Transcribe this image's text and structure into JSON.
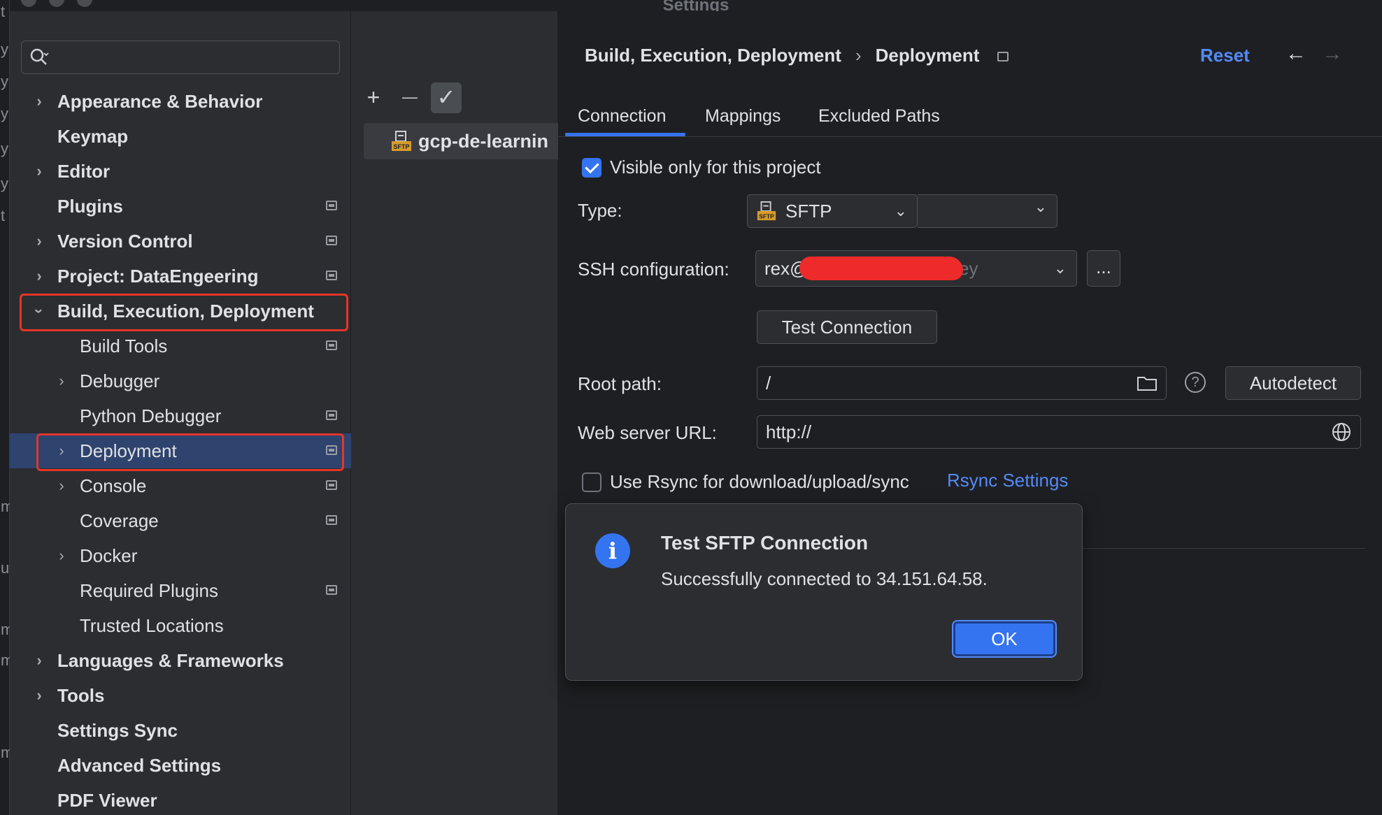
{
  "window": {
    "title": "Settings"
  },
  "sidebar": {
    "search": {
      "placeholder": ""
    },
    "items": [
      {
        "label": "Appearance & Behavior",
        "expandable": true,
        "level": 0,
        "project": false
      },
      {
        "label": "Keymap",
        "expandable": false,
        "level": 0,
        "project": false
      },
      {
        "label": "Editor",
        "expandable": true,
        "level": 0,
        "project": false
      },
      {
        "label": "Plugins",
        "expandable": false,
        "level": 0,
        "project": true
      },
      {
        "label": "Version Control",
        "expandable": true,
        "level": 0,
        "project": true
      },
      {
        "label": "Project: DataEngeering",
        "expandable": true,
        "level": 0,
        "project": true
      },
      {
        "label": "Build, Execution, Deployment",
        "expandable": true,
        "expanded": true,
        "level": 0,
        "project": false
      },
      {
        "label": "Build Tools",
        "expandable": false,
        "level": 1,
        "project": true
      },
      {
        "label": "Debugger",
        "expandable": true,
        "level": 1,
        "project": false
      },
      {
        "label": "Python Debugger",
        "expandable": false,
        "level": 1,
        "project": true
      },
      {
        "label": "Deployment",
        "expandable": true,
        "level": 1,
        "project": true,
        "selected": true
      },
      {
        "label": "Console",
        "expandable": true,
        "level": 1,
        "project": true
      },
      {
        "label": "Coverage",
        "expandable": false,
        "level": 1,
        "project": true
      },
      {
        "label": "Docker",
        "expandable": true,
        "level": 1,
        "project": false
      },
      {
        "label": "Required Plugins",
        "expandable": false,
        "level": 1,
        "project": true
      },
      {
        "label": "Trusted Locations",
        "expandable": false,
        "level": 1,
        "project": false
      },
      {
        "label": "Languages & Frameworks",
        "expandable": true,
        "level": 0,
        "project": false
      },
      {
        "label": "Tools",
        "expandable": true,
        "level": 0,
        "project": false
      },
      {
        "label": "Settings Sync",
        "expandable": false,
        "level": 0,
        "project": false
      },
      {
        "label": "Advanced Settings",
        "expandable": false,
        "level": 0,
        "project": false
      },
      {
        "label": "PDF Viewer",
        "expandable": false,
        "level": 0,
        "project": false
      }
    ]
  },
  "server_list": {
    "toolbar": {
      "add": "+",
      "remove": "—",
      "default": "✓"
    },
    "servers": [
      {
        "name": "gcp-de-learnin",
        "icon": "sftp-server-icon"
      }
    ]
  },
  "header": {
    "breadcrumb": [
      "Build, Execution, Deployment",
      "Deployment"
    ],
    "breadcrumb_sep": "›",
    "reset_label": "Reset",
    "back": "←",
    "forward": "→"
  },
  "tabs": [
    {
      "label": "Connection",
      "active": true
    },
    {
      "label": "Mappings",
      "active": false
    },
    {
      "label": "Excluded Paths",
      "active": false
    }
  ],
  "form": {
    "visible_only": {
      "label": "Visible only for this project",
      "checked": true
    },
    "type": {
      "label": "Type:",
      "value": "SFTP"
    },
    "ssh": {
      "label": "SSH configuration:",
      "value": "rex@",
      "tail": "ey",
      "more": "..."
    },
    "test_connection": "Test Connection",
    "root_path": {
      "label": "Root path:",
      "value": "/",
      "help": "?",
      "autodetect": "Autodetect"
    },
    "web_server": {
      "label": "Web server URL:",
      "value": "http://"
    },
    "rsync": {
      "label": "Use Rsync for download/upload/sync",
      "checked": false,
      "link": "Rsync Settings"
    }
  },
  "dialog": {
    "title": "Test SFTP Connection",
    "message": "Successfully connected to 34.151.64.58.",
    "ok_label": "OK",
    "icon": "i"
  },
  "edge_glyphs": [
    "t",
    "y",
    "y",
    "y",
    "y",
    "y",
    "t",
    "m",
    "u",
    "m",
    "m",
    "m"
  ],
  "colors": {
    "accent": "#3574f0",
    "link": "#548af7",
    "highlight": "#e53528",
    "selection": "#2e436e"
  }
}
